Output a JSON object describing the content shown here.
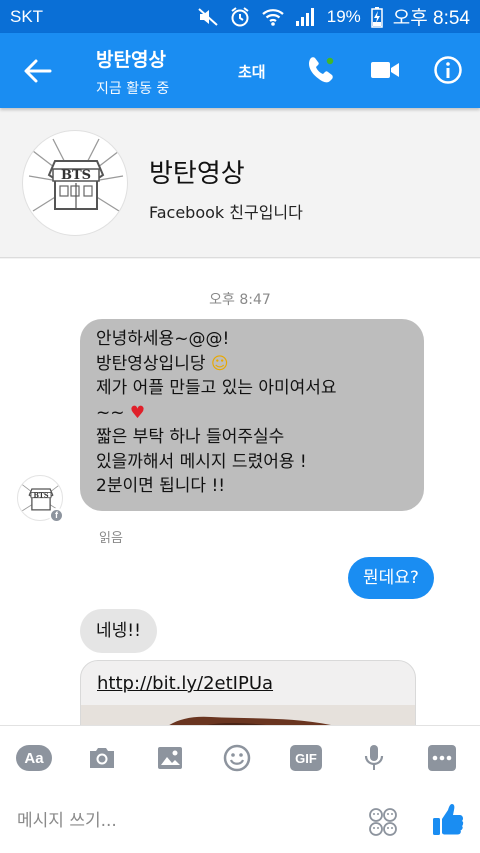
{
  "status_bar": {
    "carrier": "SKT",
    "battery": "19%",
    "time": "오후 8:54",
    "icons": [
      "mute-icon",
      "alarm-icon",
      "wifi-icon",
      "signal-icon",
      "battery-charging-icon"
    ]
  },
  "app_bar": {
    "title": "방탄영상",
    "subtitle": "지금 활동 중",
    "invite_label": "초대",
    "icons": [
      "back-arrow-icon",
      "phone-call-icon",
      "video-camera-icon",
      "info-icon"
    ]
  },
  "profile": {
    "name": "방탄영상",
    "relation": "Facebook 친구입니다",
    "avatar_logo": "BTS"
  },
  "chat": {
    "timestamp": "오후 8:47",
    "incoming_message": {
      "lines": [
        "안녕하세용~@@!",
        "방탄영상입니당 ☺",
        "제가 어플 만들고 있는 아미여서요",
        "~~ ♥",
        "짧은 부탁 하나 들어주실수",
        "있을까해서 메시지 드렸어용 !",
        "2분이면 됩니다 !!"
      ]
    },
    "read_receipt": "읽음",
    "outgoing_message": "뭔데요?",
    "incoming_message_2": "네넹!!",
    "link": "http://bit.ly/2etIPUa"
  },
  "toolbar": {
    "items": [
      "Aa",
      "camera-icon",
      "image-icon",
      "emoji-icon",
      "GIF",
      "microphone-icon",
      "more-icon"
    ]
  },
  "composer": {
    "placeholder": "메시지 쓰기...",
    "icons": [
      "stickers-icon",
      "thumbs-up-icon"
    ]
  },
  "colors": {
    "status_bar": "#0a6fd6",
    "app_bar": "#1a8df2",
    "outgoing_bubble": "#1a8df2",
    "incoming_bubble": "#bdbdbd",
    "incoming_bubble_light": "#e5e5e5",
    "toolbar_icon": "#8d949e",
    "like_icon": "#1a8df2"
  }
}
